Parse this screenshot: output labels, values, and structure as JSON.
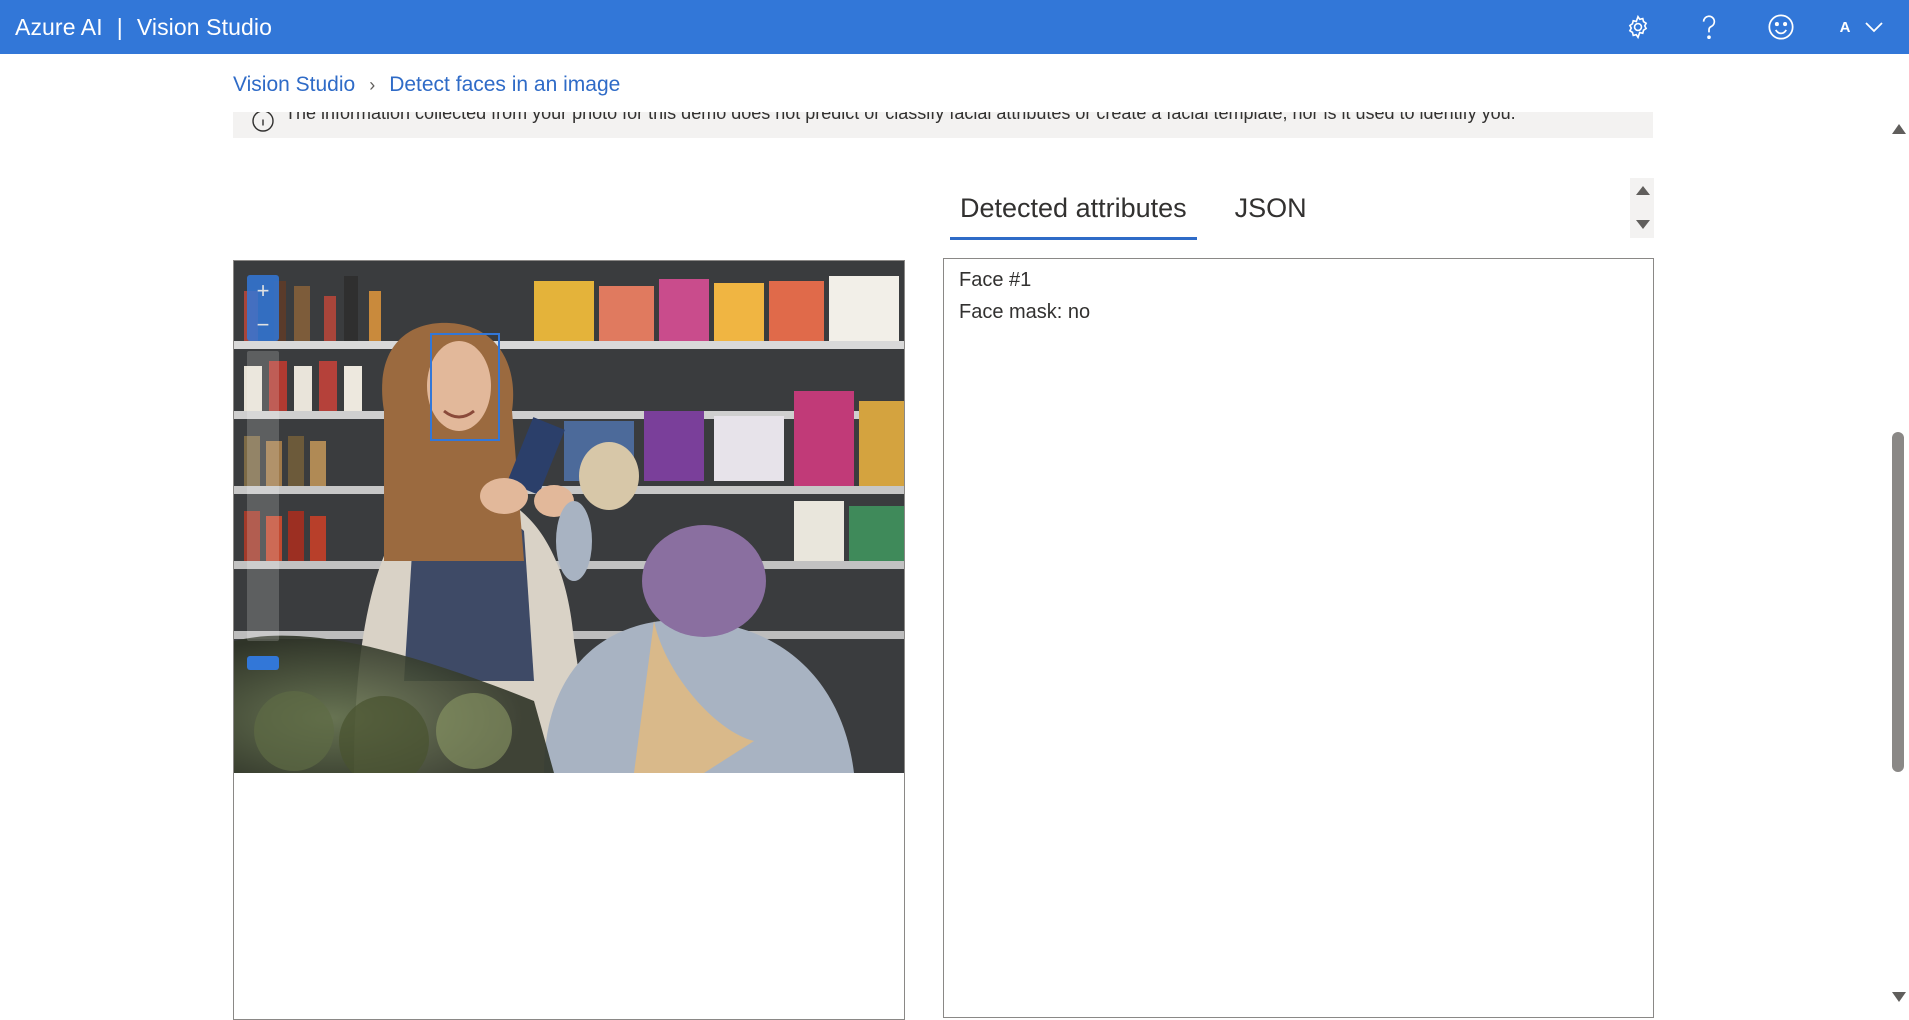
{
  "header": {
    "product": "Azure AI",
    "separator": "|",
    "app_name": "Vision Studio",
    "avatar_initial": "A",
    "icons": [
      "gear-icon",
      "help-icon",
      "smiley-icon",
      "chevron-down-icon"
    ]
  },
  "breadcrumb": {
    "items": [
      "Vision Studio",
      "Detect faces in an image"
    ]
  },
  "banner": {
    "text": "The information collected from your photo for this demo does not predict or classify facial attributes or create a facial template, nor is it used to identify you."
  },
  "image_panel": {
    "zoom_in": "+",
    "zoom_out": "−"
  },
  "tabs": [
    {
      "label": "Detected attributes",
      "active": true
    },
    {
      "label": "JSON",
      "active": false
    }
  ],
  "results": {
    "face_title": "Face #1",
    "face_mask": "Face mask: no"
  },
  "colors": {
    "header_bg": "#3277d8",
    "link": "#2f6bc7",
    "face_box": "#3277d8"
  }
}
